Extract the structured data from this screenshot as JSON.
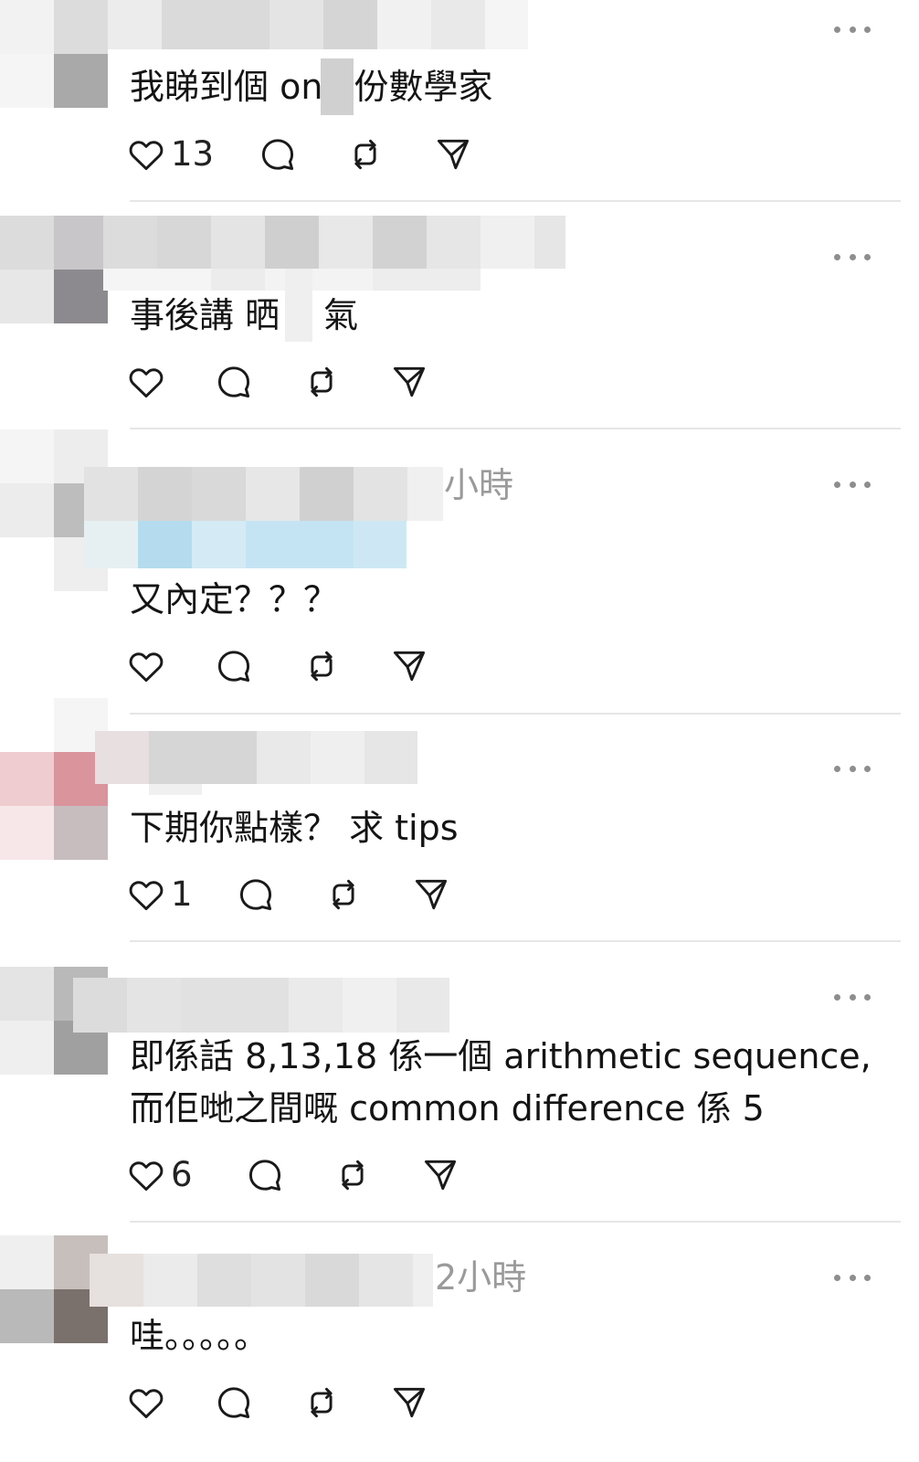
{
  "comments": [
    {
      "text": "我睇到個 on",
      "text_after": "份數學家",
      "like_count": "13",
      "timestamp": ""
    },
    {
      "text": "事後講 晒",
      "text_after": "氣",
      "like_count": "",
      "timestamp": ""
    },
    {
      "text": "又內定？？？",
      "like_count": "",
      "timestamp": "小時"
    },
    {
      "text": "下期你點樣？  求 tips",
      "like_count": "1",
      "timestamp": ""
    },
    {
      "text_line1": "即係話 8,13,18 係一個 arithmetic sequence,",
      "text_line2": "而佢哋之間嘅 common difference 係 5",
      "like_count": "6",
      "timestamp": ""
    },
    {
      "text": "哇。。。。。",
      "like_count": "",
      "timestamp": "2小時"
    }
  ],
  "icons": {
    "like": "heart-outline-icon",
    "reply": "speech-bubble-icon",
    "repost": "repost-arrows-icon",
    "share": "paper-plane-icon",
    "more": "ellipsis-icon"
  },
  "colors": {
    "icon": "#1a1a1a",
    "muted": "#9a9a9a",
    "divider": "#e6e6e6",
    "mosaic_blue": "#bfe3f2",
    "mosaic_pink": "#d9949c"
  }
}
